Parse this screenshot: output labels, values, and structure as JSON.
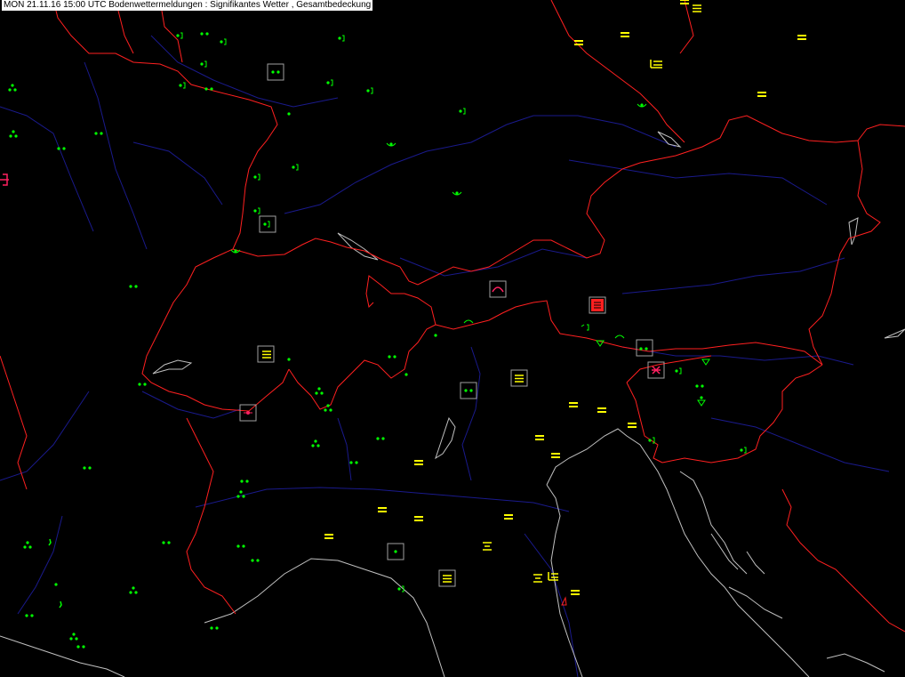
{
  "title": "MON 21.11.16 15:00 UTC  Bodenwettermeldungen :  Signifikantes Wetter , Gesamtbedeckung",
  "colors": {
    "background": "#000000",
    "borders": "#ff2020",
    "rivers": "#1a1a8c",
    "coast": "#c0c0c0",
    "rain": "#00ff00",
    "fog": "#ffff00",
    "thunder": "#ff2060",
    "frame": "#a0a0a0"
  },
  "legend_symbols": {
    "rain_dots": "two-dot-rain-icon",
    "drizzle": "drizzle-comma-icon",
    "fog": "fog-lines-icon",
    "shower": "shower-triangle-icon",
    "thunderstorm": "thunderstorm-icon",
    "recent_rain": "recent-precip-bracket-icon",
    "snow_rain": "showers-three-dot-icon"
  }
}
